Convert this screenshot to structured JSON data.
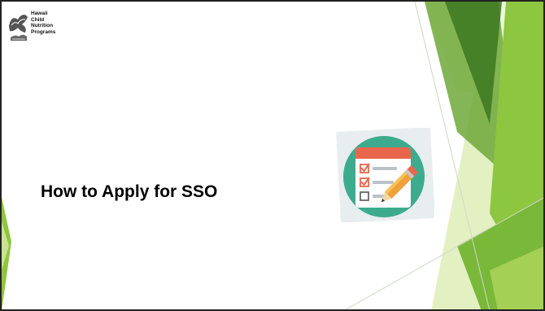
{
  "slide": {
    "title": "How to Apply for SSO",
    "logo": {
      "lines": [
        "Hawaii",
        "Child",
        "Nutrition",
        "Programs"
      ]
    },
    "illustration": {
      "icon": "checklist-pencil-icon",
      "items": 3,
      "checked_items": 2
    }
  },
  "colors": {
    "accent_green": "#8dc63f",
    "dark_green": "#4e8a2a",
    "light_green": "#d6e9a5",
    "teal_circle": "#3dab8e",
    "clipboard_header": "#e8674c",
    "pencil_orange": "#f0a23a",
    "title_text": "#000000",
    "frame_border": "#222222"
  }
}
